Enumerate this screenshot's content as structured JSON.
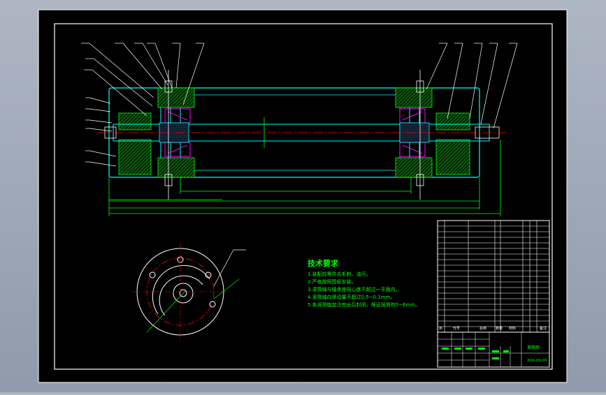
{
  "drawing": {
    "colors": {
      "background": "#000000",
      "frame": "#ffffff",
      "section_outline": "#00ffff",
      "center_line": "#ff0000",
      "dimension": "#00ff00",
      "hatch": "#00ff00",
      "leader": "#ffffff",
      "bearing": "#ff00ff",
      "notes": "#00ff00",
      "table": "#ffffff"
    },
    "notes": {
      "title": "技术要求",
      "items": [
        "1.装配前零件去毛刺、油污。",
        "2.严格按照图纸安装。",
        "3.滚筒轴与轴承座同心度不超过一平面内。",
        "4.滚筒轴向窜动量不超过0.5~0.1mm。",
        "5.各润滑脂加注完全后封闭，保证润滑剂5~6mm。"
      ]
    },
    "title_block": {
      "drawing_name": "滚筒图",
      "drawing_number": "XXX-00-00",
      "header_cells": [
        "序",
        "代号",
        "名称",
        "数量",
        "材料",
        "备注"
      ]
    }
  }
}
